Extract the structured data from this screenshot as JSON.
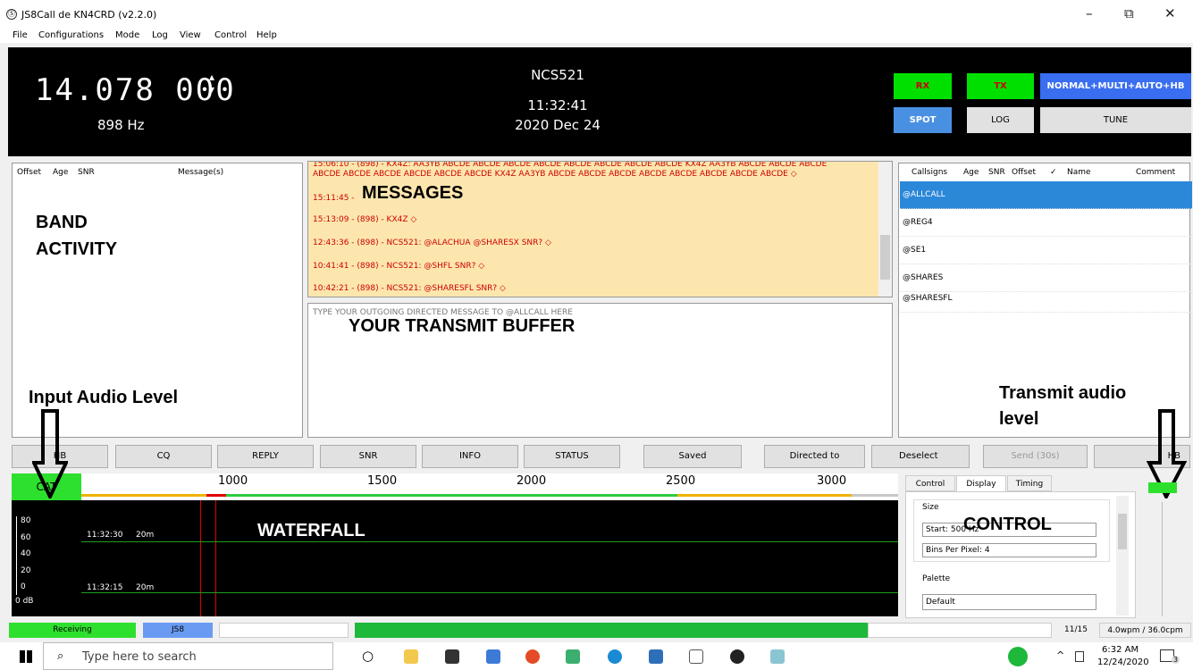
{
  "window": {
    "logo": "Ⓢ",
    "title": "JS8Call de KN4CRD (v2.2.0)",
    "min": "–",
    "max": "⧉",
    "close": "✕"
  },
  "menu": [
    "File",
    "Configurations",
    "Mode",
    "Log",
    "View",
    "Control",
    "Help"
  ],
  "header": {
    "frequency": "14.078 000",
    "spin_up": "▴",
    "spin_down": "▾",
    "offset_hz": "898 Hz",
    "callsign": "NCS521",
    "time": "11:32:41",
    "date": "2020 Dec 24"
  },
  "mode_buttons": {
    "rx": "RX",
    "tx": "TX",
    "mode": "NORMAL+MULTI+AUTO+HB",
    "spot": "SPOT",
    "log": "LOG",
    "tune": "TUNE"
  },
  "colors": {
    "rx_green": "#00e000",
    "spot_blue": "#4a90e2",
    "mode_blue": "#3a6ef0",
    "status_green": "#2ee02e",
    "messages_bg": "#fde6ae",
    "msg_red": "#cc0000",
    "selected_row": "#2b88d8"
  },
  "band_activity": {
    "headers": [
      "Offset",
      "Age",
      "SNR",
      "Message(s)"
    ],
    "overlay": [
      "BAND",
      "ACTIVITY"
    ]
  },
  "messages": {
    "overlay": "MESSAGES",
    "lines": [
      "15:06:10 - (898) - KX4Z: AA3YB  ABCDE ABCDE ABCDE ABCDE ABCDE ABCDE ABCDE ABCDE KX4Z AA3YB ABCDE ABCDE ABCDE",
      "ABCDE ABCDE ABCDE ABCDE ABCDE ABCDE KX4Z AA3YB ABCDE ABCDE ABCDE ABCDE ABCDE ABCDE ABCDE ABCDE ◇",
      "15:11:45 -",
      "15:13:09 - (898) - KX4Z ◇",
      "12:43:36 - (898) - NCS521: @ALACHUA  @SHARESX SNR? ◇",
      "10:41:41 - (898) - NCS521: @SHFL SNR? ◇",
      "10:42:21 - (898) - NCS521: @SHARESFL SNR? ◇"
    ]
  },
  "transmit": {
    "placeholder": "TYPE YOUR OUTGOING DIRECTED MESSAGE TO @ALLCALL HERE",
    "overlay": "YOUR TRANSMIT BUFFER"
  },
  "calls": {
    "headers": [
      "Callsigns",
      "Age",
      "SNR",
      "Offset",
      "✓",
      "Name",
      "Comment"
    ],
    "rows": [
      "@ALLCALL",
      "@REG4",
      "@SE1",
      "@SHARES",
      "@SHARESFL"
    ]
  },
  "labels": {
    "input_audio": "Input Audio Level",
    "transmit_audio": [
      "Transmit audio",
      "level"
    ],
    "waterfall": "WATERFALL",
    "control": "CONTROL"
  },
  "buttons": [
    "HB",
    "CQ",
    "REPLY",
    "SNR",
    "INFO",
    "STATUS",
    "Saved",
    "Directed to @ALLCALL",
    "Deselect",
    "Send (30s)",
    "HB"
  ],
  "waterfall": {
    "cat": "CAT",
    "ticks": [
      "1000",
      "1500",
      "2000",
      "2500",
      "3000"
    ],
    "rows": [
      {
        "time": "11:32:30",
        "band": "20m"
      },
      {
        "time": "11:32:15",
        "band": "20m"
      }
    ],
    "db_scale": [
      "80",
      "60",
      "40",
      "20",
      "0"
    ],
    "db_label": "0 dB"
  },
  "control_panel": {
    "tabs": [
      "Control",
      "Display",
      "Timing"
    ],
    "active_tab": "Display",
    "size_label": "Size",
    "start": "Start: 500 Hz",
    "bins": "Bins Per Pixel: 4",
    "palette_label": "Palette",
    "palette": "Default"
  },
  "status": {
    "receiving": "Receiving",
    "mode": "JS8",
    "count": "11/15",
    "wpm": "4.0wpm / 36.0cpm"
  },
  "taskbar": {
    "search": "Type here to search",
    "time": "6:32 AM",
    "date": "12/24/2020",
    "notif": "3"
  }
}
